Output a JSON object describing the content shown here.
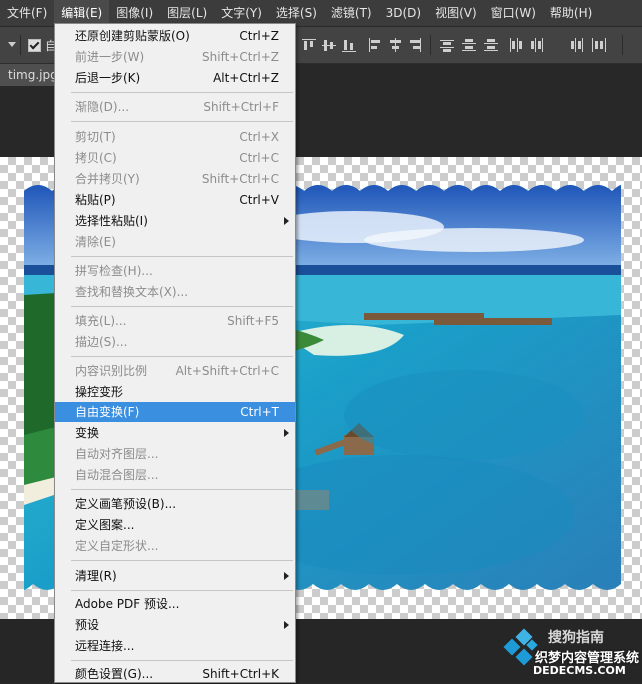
{
  "menubar": {
    "items": [
      "文件(F)",
      "编辑(E)",
      "图像(I)",
      "图层(L)",
      "文字(Y)",
      "选择(S)",
      "滤镜(T)",
      "3D(D)",
      "视图(V)",
      "窗口(W)",
      "帮助(H)"
    ],
    "active": "编辑(E)"
  },
  "options_bar": {
    "auto_select_label": "自",
    "auto_select_checked": true
  },
  "document": {
    "tab_label": "timg.jpg"
  },
  "edit_menu": {
    "items": [
      {
        "label": "还原创建剪贴蒙版(O)",
        "shortcut": "Ctrl+Z",
        "enabled": true
      },
      {
        "label": "前进一步(W)",
        "shortcut": "Shift+Ctrl+Z",
        "enabled": false
      },
      {
        "label": "后退一步(K)",
        "shortcut": "Alt+Ctrl+Z",
        "enabled": true
      },
      {
        "label": "渐隐(D)...",
        "shortcut": "Shift+Ctrl+F",
        "enabled": false
      },
      {
        "label": "剪切(T)",
        "shortcut": "Ctrl+X",
        "enabled": false
      },
      {
        "label": "拷贝(C)",
        "shortcut": "Ctrl+C",
        "enabled": false
      },
      {
        "label": "合并拷贝(Y)",
        "shortcut": "Shift+Ctrl+C",
        "enabled": false
      },
      {
        "label": "粘贴(P)",
        "shortcut": "Ctrl+V",
        "enabled": true
      },
      {
        "label": "选择性粘贴(I)",
        "shortcut": "",
        "enabled": true,
        "submenu": true
      },
      {
        "label": "清除(E)",
        "shortcut": "",
        "enabled": false
      },
      {
        "label": "拼写检查(H)...",
        "shortcut": "",
        "enabled": false
      },
      {
        "label": "查找和替换文本(X)...",
        "shortcut": "",
        "enabled": false
      },
      {
        "label": "填充(L)...",
        "shortcut": "Shift+F5",
        "enabled": false
      },
      {
        "label": "描边(S)...",
        "shortcut": "",
        "enabled": false
      },
      {
        "label": "内容识别比例",
        "shortcut": "Alt+Shift+Ctrl+C",
        "enabled": false
      },
      {
        "label": "操控变形",
        "shortcut": "",
        "enabled": true
      },
      {
        "label": "自由变换(F)",
        "shortcut": "Ctrl+T",
        "enabled": true,
        "highlighted": true
      },
      {
        "label": "变换",
        "shortcut": "",
        "enabled": true,
        "submenu": true
      },
      {
        "label": "自动对齐图层...",
        "shortcut": "",
        "enabled": false
      },
      {
        "label": "自动混合图层...",
        "shortcut": "",
        "enabled": false
      },
      {
        "label": "定义画笔预设(B)...",
        "shortcut": "",
        "enabled": true
      },
      {
        "label": "定义图案...",
        "shortcut": "",
        "enabled": true
      },
      {
        "label": "定义自定形状...",
        "shortcut": "",
        "enabled": false
      },
      {
        "label": "清理(R)",
        "shortcut": "",
        "enabled": true,
        "submenu": true
      },
      {
        "label": "Adobe PDF 预设...",
        "shortcut": "",
        "enabled": true
      },
      {
        "label": "预设",
        "shortcut": "",
        "enabled": true,
        "submenu": true
      },
      {
        "label": "远程连接...",
        "shortcut": "",
        "enabled": true
      },
      {
        "label": "颜色设置(G)...",
        "shortcut": "Shift+Ctrl+K",
        "enabled": true
      }
    ]
  },
  "watermark": {
    "line1": "搜狗指南",
    "line2": "织梦内容管理系统",
    "line3": "DEDECMS.COM"
  },
  "colors": {
    "menu_highlight": "#3a8fe0",
    "menubar_bg": "#3c3c3c",
    "menu_bg": "#f0f0f0"
  }
}
